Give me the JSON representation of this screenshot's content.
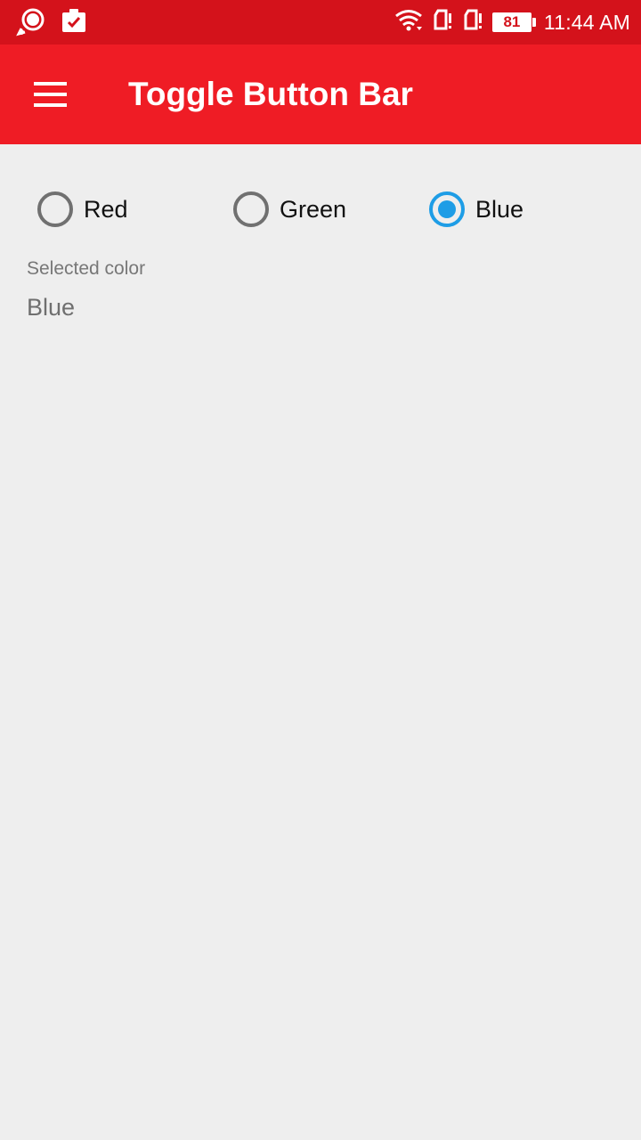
{
  "status_bar": {
    "time": "11:44 AM",
    "battery_level": "81",
    "icons": [
      "pokemon-go-icon",
      "clipboard-check-icon",
      "wifi-icon",
      "sim-card-1-icon",
      "sim-card-2-icon",
      "battery-icon"
    ],
    "background": "#d4121b"
  },
  "app_bar": {
    "title": "Toggle Button Bar",
    "menu_icon": "hamburger-menu-icon",
    "background": "#ef1c25"
  },
  "radio_group": {
    "options": [
      {
        "label": "Red",
        "checked": false
      },
      {
        "label": "Green",
        "checked": false
      },
      {
        "label": "Blue",
        "checked": true
      }
    ],
    "accent": "#1e9de6"
  },
  "selection": {
    "caption": "Selected color",
    "value": "Blue"
  }
}
